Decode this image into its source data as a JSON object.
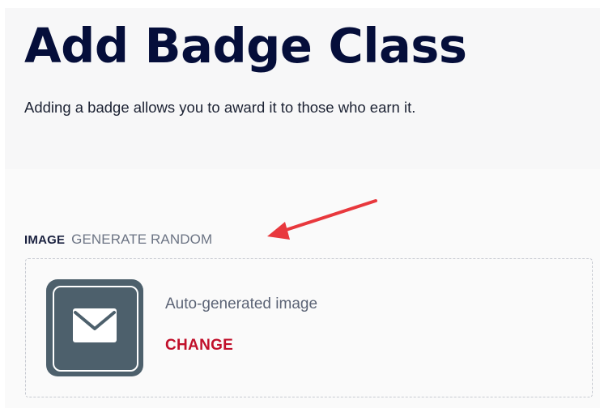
{
  "header": {
    "title": "Add Badge Class",
    "subtitle": "Adding a badge allows you to award it to those who earn it."
  },
  "image_field": {
    "label": "IMAGE",
    "generate_random_label": "GENERATE RANDOM",
    "caption": "Auto-generated image",
    "change_label": "CHANGE",
    "thumbnail_icon": "envelope-icon"
  },
  "colors": {
    "title": "#050e3a",
    "link_red": "#c1102b",
    "annotation_arrow": "#e8383d",
    "thumbnail_bg": "#4d606c"
  }
}
